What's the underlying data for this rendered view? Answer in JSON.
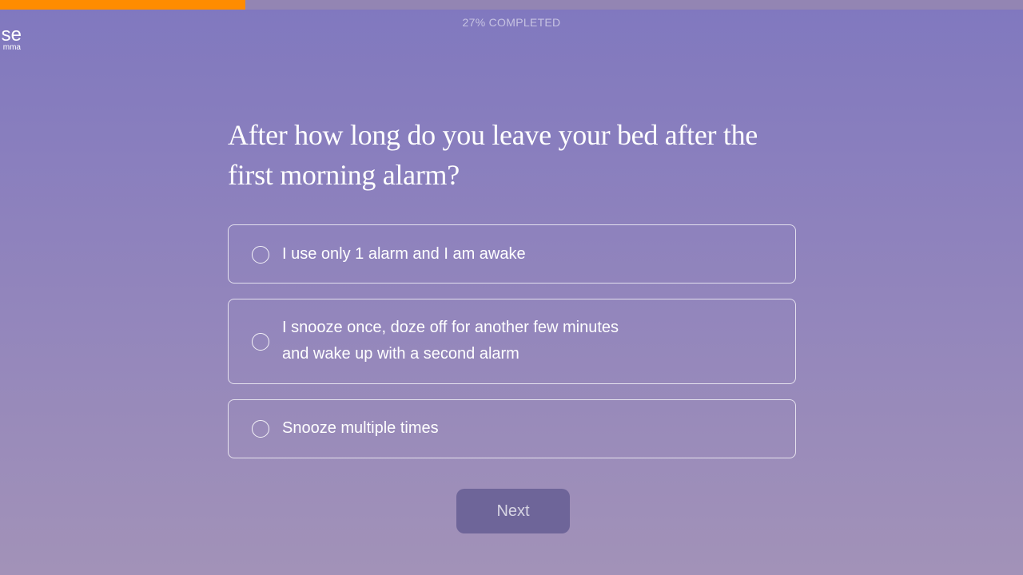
{
  "progress": {
    "percent": 24,
    "label": "27% COMPLETED",
    "fill_color": "#ff8c00"
  },
  "logo": {
    "main": "se",
    "sub": "mma"
  },
  "question": {
    "text": "After how long do you leave your bed after the first morning alarm?"
  },
  "options": [
    {
      "label": "I use only 1 alarm and I am awake",
      "selected": false
    },
    {
      "label": "I snooze once, doze off for another few minutes\nand wake up with a second alarm",
      "selected": false
    },
    {
      "label": "Snooze multiple times",
      "selected": false
    }
  ],
  "next_button": {
    "label": "Next",
    "disabled": true
  },
  "colors": {
    "background_top": "#8078bf",
    "background_bottom": "#a292b8",
    "button": "#6e6599"
  }
}
